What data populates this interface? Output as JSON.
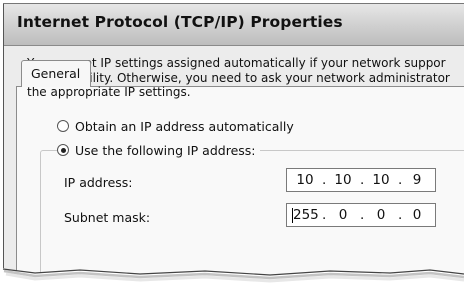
{
  "window": {
    "title": "Internet Protocol (TCP/IP) Properties"
  },
  "tabs": [
    {
      "label": "General"
    }
  ],
  "description": "You can get IP settings assigned automatically if your network suppor\nthis capability. Otherwise, you need to ask your network administrator\nthe appropriate IP settings.",
  "options": {
    "auto": {
      "label": "Obtain an IP address automatically",
      "checked": false
    },
    "manual": {
      "label": "Use the following IP address:",
      "checked": true
    }
  },
  "fields": {
    "ip_address": {
      "label": "IP address:",
      "octets": [
        "10",
        "10",
        "10",
        "9"
      ]
    },
    "subnet_mask": {
      "label": "Subnet mask:",
      "octets": [
        "255",
        "0",
        "0",
        "0"
      ]
    }
  }
}
